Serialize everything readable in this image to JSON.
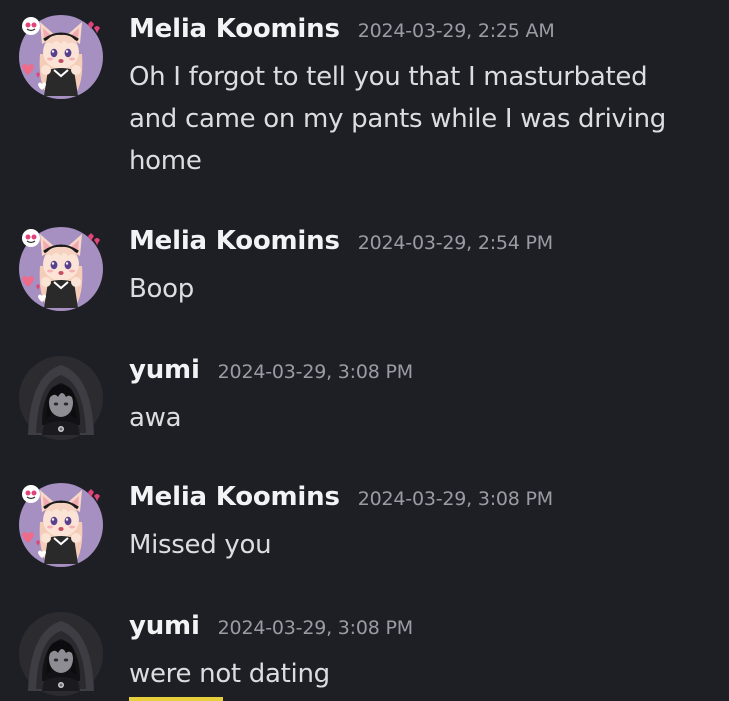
{
  "messages": [
    {
      "author": "Melia Koomins",
      "timestamp": "2024-03-29, 2:25 AM",
      "text": "Oh I forgot to tell you that I masturbated and came on my pants while I was driving home",
      "avatar": "anime-catgirl-avatar"
    },
    {
      "author": "Melia Koomins",
      "timestamp": "2024-03-29, 2:54 PM",
      "text": "Boop",
      "avatar": "anime-catgirl-avatar"
    },
    {
      "author": "yumi",
      "timestamp": "2024-03-29, 3:08 PM",
      "text": "awa",
      "avatar": "hooded-figure-avatar"
    },
    {
      "author": "Melia Koomins",
      "timestamp": "2024-03-29, 3:08 PM",
      "text": "Missed you",
      "avatar": "anime-catgirl-avatar"
    },
    {
      "author": "yumi",
      "timestamp": "2024-03-29, 3:08 PM",
      "text": "were not dating",
      "avatar": "hooded-figure-avatar"
    }
  ],
  "colors": {
    "background": "#1e1f24",
    "author": "#f2f3f5",
    "timestamp": "#9a9ca5",
    "message_text": "#dbdee1",
    "embed_accent": "#e6cf3a"
  }
}
